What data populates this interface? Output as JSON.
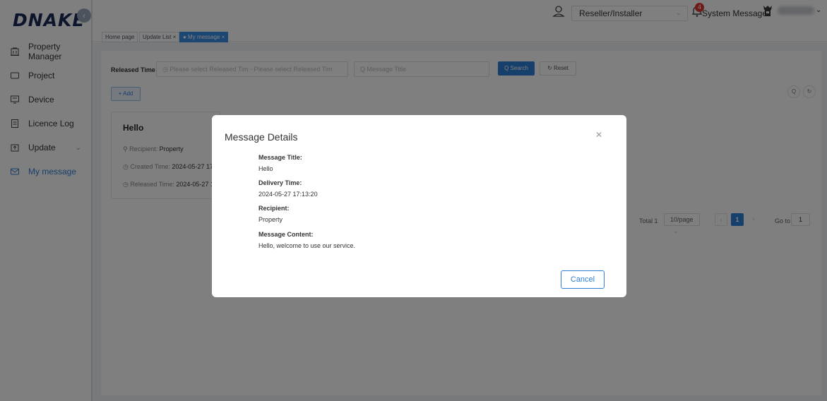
{
  "brand": {
    "logo_text": "DNAKE"
  },
  "sidebar": {
    "items": [
      {
        "label": "Property Manager",
        "icon": "building-icon"
      },
      {
        "label": "Project",
        "icon": "project-icon"
      },
      {
        "label": "Device",
        "icon": "device-icon"
      },
      {
        "label": "Licence Log",
        "icon": "log-icon"
      },
      {
        "label": "Update",
        "icon": "update-icon"
      },
      {
        "label": "My message",
        "icon": "message-icon",
        "active": true
      }
    ]
  },
  "header": {
    "role": "Reseller/Installer",
    "notification_count": "4",
    "system_message_label": "System Message"
  },
  "tabs": [
    {
      "label": "Home page"
    },
    {
      "label": "Update List ×"
    },
    {
      "label": "● My message ×",
      "active": true
    }
  ],
  "filters": {
    "released_time_label": "Released Time",
    "date_range_placeholder": "◷  Please select Released Tim   -   Please select Released Tim",
    "title_placeholder": "Q  Message Title",
    "search_label": "Q Search",
    "reset_label": "↻ Reset",
    "add_label": "+ Add"
  },
  "message_card": {
    "title": "Hello",
    "recipient_label": "Recipient:",
    "recipient_value": "Property",
    "created_label": "Created Time:",
    "created_value": "2024-05-27 17",
    "released_label": "Released Time:",
    "released_value": "2024-05-27 1"
  },
  "pagination": {
    "total": "Total 1",
    "page_size": "10/page",
    "current_page": "1",
    "goto_label": "Go to",
    "goto_value": "1"
  },
  "modal": {
    "title": "Message Details",
    "fields": [
      {
        "label": "Message Title:",
        "value": "Hello"
      },
      {
        "label": "Delivery Time:",
        "value": "2024-05-27 17:13:20"
      },
      {
        "label": "Recipient:",
        "value": "Property"
      },
      {
        "label": "Message Content:",
        "value": "Hello, welcome to use our service."
      }
    ],
    "cancel_label": "Cancel"
  },
  "colors": {
    "primary": "#2f7fd8",
    "badge": "#e0332c",
    "brand": "#1a2a5a"
  }
}
